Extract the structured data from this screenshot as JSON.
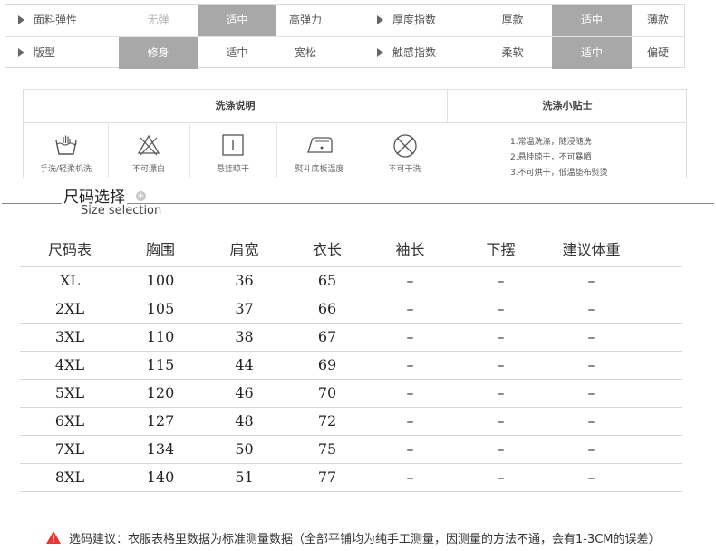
{
  "attributes": {
    "rows": [
      [
        {
          "label": "面料弹性",
          "options": [
            {
              "text": "无弹",
              "state": "muted"
            },
            {
              "text": "适中",
              "state": "selected"
            },
            {
              "text": "高弹力",
              "state": "normal"
            }
          ]
        },
        {
          "label": "厚度指数",
          "options": [
            {
              "text": "厚款",
              "state": "normal"
            },
            {
              "text": "适中",
              "state": "selected"
            },
            {
              "text": "薄款",
              "state": "normal"
            }
          ]
        }
      ],
      [
        {
          "label": "版型",
          "options": [
            {
              "text": "修身",
              "state": "selected"
            },
            {
              "text": "适中",
              "state": "normal"
            },
            {
              "text": "宽松",
              "state": "normal"
            }
          ]
        },
        {
          "label": "触感指数",
          "options": [
            {
              "text": "柔软",
              "state": "normal"
            },
            {
              "text": "适中",
              "state": "selected"
            },
            {
              "text": "偏硬",
              "state": "normal"
            }
          ]
        }
      ]
    ]
  },
  "washing": {
    "instructions_title": "洗涤说明",
    "tips_title": "洗涤小贴士",
    "icons": [
      {
        "icon": "hand-wash-icon",
        "caption": "手洗/轻柔机洗"
      },
      {
        "icon": "no-bleach-icon",
        "caption": "不可漂白"
      },
      {
        "icon": "hang-dry-icon",
        "caption": "悬挂晾干"
      },
      {
        "icon": "iron-icon",
        "caption": "熨斗底板温度"
      },
      {
        "icon": "no-dry-clean-icon",
        "caption": "不可干洗"
      }
    ],
    "tips": [
      "1.常温洗涤，随浸随洗",
      "2.悬挂晾干，不可暴晒",
      "3.不可烘干，低温垫布熨烫"
    ]
  },
  "size_section": {
    "title": "尺码选择",
    "subtitle": "Size selection"
  },
  "size_chart": {
    "headers": [
      "尺码表",
      "胸围",
      "肩宽",
      "衣长",
      "袖长",
      "下摆",
      "建议体重"
    ],
    "rows": [
      [
        "XL",
        "100",
        "36",
        "65",
        "–",
        "–",
        "–"
      ],
      [
        "2XL",
        "105",
        "37",
        "66",
        "–",
        "–",
        "–"
      ],
      [
        "3XL",
        "110",
        "38",
        "67",
        "–",
        "–",
        "–"
      ],
      [
        "4XL",
        "115",
        "44",
        "69",
        "–",
        "–",
        "–"
      ],
      [
        "5XL",
        "120",
        "46",
        "70",
        "–",
        "–",
        "–"
      ],
      [
        "6XL",
        "127",
        "48",
        "72",
        "–",
        "–",
        "–"
      ],
      [
        "7XL",
        "134",
        "50",
        "75",
        "–",
        "–",
        "–"
      ],
      [
        "8XL",
        "140",
        "51",
        "77",
        "–",
        "–",
        "–"
      ]
    ]
  },
  "note": {
    "icon": "warning-icon",
    "text": "选码建议：衣服表格里数据为标准测量数据（全部平铺均为纯手工测量，因测量的方法不通，会有1-3CM的误差）"
  },
  "colors": {
    "selected_bg": "#a8a8a8",
    "warning": "#e53935"
  }
}
